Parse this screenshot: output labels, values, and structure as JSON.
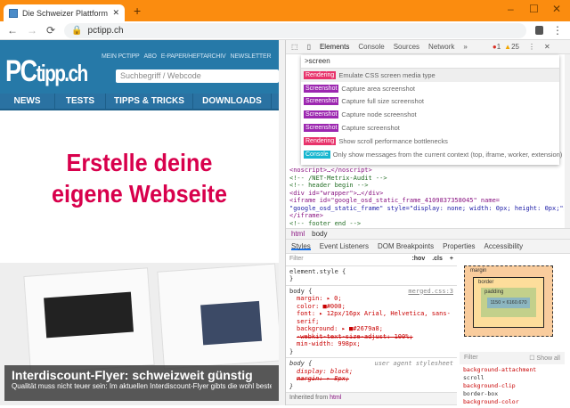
{
  "browser": {
    "tab_title": "Die Schweizer Plattform für Computer",
    "url": "pctipp.ch",
    "close_tab": "✕",
    "new_tab": "+",
    "back": "←",
    "forward": "→",
    "reload": "⟳",
    "min": "–",
    "max": "☐",
    "close": "✕",
    "menu": "⋮"
  },
  "site": {
    "logo_pc": "PC",
    "logo_rest": "tipp.ch",
    "top_links": [
      "MEIN PCTIPP",
      "ABO",
      "E-PAPER/HEFTARCHIV",
      "NEWSLETTER"
    ],
    "search_placeholder": "Suchbegriff / Webcode",
    "nav": [
      "NEWS",
      "TESTS",
      "TIPPS & TRICKS",
      "DOWNLOADS"
    ],
    "ad_line1": "Erstelle deine",
    "ad_line2": "eigene Webseite",
    "flyer_title": "Interdiscount-Flyer: schweizweit günstig",
    "flyer_sub": "Qualität muss nicht teuer sein: Im aktuellen Interdiscount-Flyer gibts die wohl besten"
  },
  "devtools": {
    "tabs": [
      "Elements",
      "Console",
      "Sources",
      "Network",
      "»"
    ],
    "errors": "1",
    "warnings": "25",
    "palette_input": ">screen",
    "palette_items": [
      {
        "badge": "Rendering",
        "color": "#e8336b",
        "text": "Emulate CSS screen media type"
      },
      {
        "badge": "Screenshot",
        "color": "#9c27b0",
        "text": "Capture area screenshot"
      },
      {
        "badge": "Screenshot",
        "color": "#9c27b0",
        "text": "Capture full size screenshot"
      },
      {
        "badge": "Screenshot",
        "color": "#9c27b0",
        "text": "Capture node screenshot"
      },
      {
        "badge": "Screenshot",
        "color": "#9c27b0",
        "text": "Capture screenshot"
      },
      {
        "badge": "Rendering",
        "color": "#e8336b",
        "text": "Show scroll performance bottlenecks"
      },
      {
        "badge": "Console",
        "color": "#17b6cf",
        "text": "Only show messages from the current context (top, iframe, worker, extension)"
      }
    ],
    "tree": [
      "<noscript>…</noscript>",
      "<!-- /NET-Metrix-Audit -->",
      "<!-- header begin -->",
      "<div id=\"wrapper\">…</div>",
      "<iframe id=\"google_osd_static_frame_4109837358045\" name=",
      "\"google_osd_static_frame\" style=\"display: none; width: 0px; height: 0px;\">…",
      "</iframe>",
      "<!-- footer end -->"
    ],
    "crumbs": [
      "html",
      "body"
    ],
    "subtabs": [
      "Styles",
      "Event Listeners",
      "DOM Breakpoints",
      "Properties",
      "Accessibility"
    ],
    "filter": "Filter",
    "hov": ":hov",
    "cls": ".cls",
    "plus": "+",
    "element_style": "element.style {",
    "close_brace": "}",
    "body_sel": "body {",
    "body_src": "merged.css:3",
    "body_props": [
      "margin: ▸ 0;",
      "color: ■#000;",
      "font: ▸ 12px/16px Arial, Helvetica, sans-serif;",
      "background: ▸ ■#2679a8;",
      "-webkit-text-size-adjust: 100%;",
      "min-width: 998px;"
    ],
    "ua_sel": "body {",
    "ua_src": "user agent stylesheet",
    "ua_props": [
      "display: block;",
      "margin: ▸ 8px;"
    ],
    "inherited": "Inherited from",
    "inherited_el": "html",
    "box": {
      "margin": "margin",
      "border": "border",
      "padding": "padding",
      "content": "1150 × 6160.670",
      "dash": "–"
    },
    "computed_filter": "Filter",
    "show_all": "Show all",
    "computed": [
      {
        "prop": "background-attachment",
        "val": "scroll"
      },
      {
        "prop": "background-clip",
        "val": "border-box"
      },
      {
        "prop": "background-color",
        "val": ""
      }
    ]
  }
}
